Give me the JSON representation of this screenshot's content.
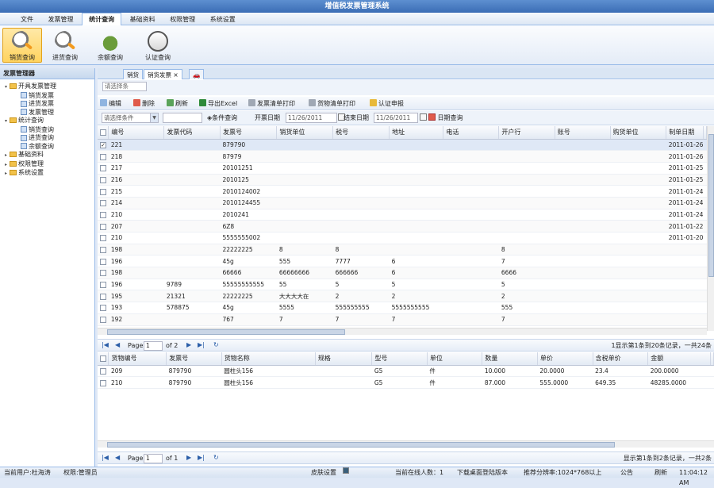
{
  "app": {
    "title": "增值税发票管理系统"
  },
  "menu": [
    "文件",
    "发票管理",
    "统计查询",
    "基础资料",
    "权限管理",
    "系统设置"
  ],
  "ribbon": [
    {
      "label": "销货查询",
      "icon": "magnifier-icon"
    },
    {
      "label": "进货查询",
      "icon": "magnifier-icon"
    },
    {
      "label": "余额查询",
      "icon": "money-bag-icon"
    },
    {
      "label": "认证查询",
      "icon": "id-card-icon"
    }
  ],
  "sidebar": {
    "title": "发票管理器",
    "tree": [
      {
        "label": "开具发票管理",
        "level": 1,
        "expanded": true,
        "kind": "folder"
      },
      {
        "label": "销货发票",
        "level": 2,
        "kind": "doc"
      },
      {
        "label": "进货发票",
        "level": 2,
        "kind": "doc"
      },
      {
        "label": "发票管理",
        "level": 2,
        "kind": "doc"
      },
      {
        "label": "统计查询",
        "level": 1,
        "expanded": true,
        "kind": "folder"
      },
      {
        "label": "销货查询",
        "level": 2,
        "kind": "doc"
      },
      {
        "label": "进货查询",
        "level": 2,
        "kind": "doc"
      },
      {
        "label": "余额查询",
        "level": 2,
        "kind": "doc"
      },
      {
        "label": "基础资料",
        "level": 1,
        "kind": "folder"
      },
      {
        "label": "权限管理",
        "level": 1,
        "kind": "folder"
      },
      {
        "label": "系统设置",
        "level": 1,
        "kind": "folder"
      }
    ]
  },
  "tabs": [
    "销货",
    "销货发票"
  ],
  "search": {
    "placeholder": "请选择条"
  },
  "toolbar": {
    "edit": "编辑",
    "delete": "删除",
    "refresh": "刷新",
    "export": "导出Excel",
    "print_invoice": "发票清单打印",
    "print_goods": "货物清单打印",
    "certify": "认证申报"
  },
  "filter": {
    "condition_placeholder": "请选择条件",
    "condition_query": "条件查询",
    "start_label": "开票日期",
    "start_value": "11/26/2011",
    "end_label": "结束日期",
    "end_value": "11/26/2011",
    "date_query": "日期查询"
  },
  "grid1": {
    "columns": [
      "编号",
      "发票代码",
      "发票号",
      "销货单位",
      "税号",
      "地址",
      "电话",
      "开户行",
      "账号",
      "购货单位",
      "制单日期"
    ],
    "rows": [
      {
        "checked": true,
        "cells": [
          "221",
          "",
          "879790",
          "",
          "",
          "",
          "",
          "",
          "",
          "",
          "2011-01-26"
        ]
      },
      {
        "cells": [
          "218",
          "",
          "87979",
          "",
          "",
          "",
          "",
          "",
          "",
          "",
          "2011-01-26"
        ]
      },
      {
        "cells": [
          "217",
          "",
          "20101251",
          "",
          "",
          "",
          "",
          "",
          "",
          "",
          "2011-01-25"
        ]
      },
      {
        "cells": [
          "216",
          "",
          "2010125",
          "",
          "",
          "",
          "",
          "",
          "",
          "",
          "2011-01-25"
        ]
      },
      {
        "cells": [
          "215",
          "",
          "2010124002",
          "",
          "",
          "",
          "",
          "",
          "",
          "",
          "2011-01-24"
        ]
      },
      {
        "cells": [
          "214",
          "",
          "2010124455",
          "",
          "",
          "",
          "",
          "",
          "",
          "",
          "2011-01-24"
        ]
      },
      {
        "cells": [
          "210",
          "",
          "2010241",
          "",
          "",
          "",
          "",
          "",
          "",
          "",
          "2011-01-24"
        ]
      },
      {
        "cells": [
          "207",
          "",
          "6Z8",
          "",
          "",
          "",
          "",
          "",
          "",
          "",
          "2011-01-22"
        ]
      },
      {
        "cells": [
          "210",
          "",
          "5555555002",
          "",
          "",
          "",
          "",
          "",
          "",
          "",
          "2011-01-20"
        ]
      },
      {
        "cells": [
          "198",
          "",
          "22222225",
          "8",
          "8",
          "",
          "",
          "8",
          "",
          "",
          ""
        ]
      },
      {
        "cells": [
          "196",
          "",
          "45g",
          "555",
          "7777",
          "6",
          "",
          "7",
          "",
          "",
          ""
        ]
      },
      {
        "cells": [
          "198",
          "",
          "66666",
          "66666666",
          "666666",
          "6",
          "",
          "6666",
          "",
          "",
          ""
        ]
      },
      {
        "cells": [
          "196",
          "9789",
          "55555555555",
          "55",
          "5",
          "5",
          "",
          "5",
          "",
          "",
          ""
        ]
      },
      {
        "cells": [
          "195",
          "21321",
          "22222225",
          "大大大大在",
          "2",
          "2",
          "",
          "2",
          "",
          "",
          ""
        ]
      },
      {
        "cells": [
          "193",
          "578875",
          "45g",
          "5555",
          "555555555",
          "5555555555",
          "",
          "555",
          "",
          "",
          ""
        ]
      },
      {
        "cells": [
          "192",
          "",
          "767",
          "7",
          "7",
          "7",
          "",
          "7",
          "",
          "",
          ""
        ]
      }
    ]
  },
  "pager1": {
    "page_label": "Page",
    "page": "1",
    "of": "of 2",
    "summary": "1显示第1条到20条记录，一共24条"
  },
  "grid2": {
    "columns": [
      "货物编号",
      "发票号",
      "货物名称",
      "规格",
      "型号",
      "单位",
      "数量",
      "单价",
      "含税单价",
      "金额"
    ],
    "rows": [
      [
        "209",
        "879790",
        "圆柱头156",
        "",
        "G5",
        "件",
        "10.000",
        "20.0000",
        "23.4",
        "200.0000"
      ],
      [
        "210",
        "879790",
        "圆柱头156",
        "",
        "G5",
        "件",
        "87.000",
        "555.0000",
        "649.35",
        "48285.0000"
      ]
    ]
  },
  "pager2": {
    "page_label": "Page",
    "page": "1",
    "of": "of 1",
    "summary": "显示第1条到2条记录，一共2条"
  },
  "status": {
    "user": "当前用户:杜海涛",
    "role": "权限:管理员",
    "skin_label": "皮肤设置",
    "online": "当前在线人数：1",
    "download": "下载桌面登陆版本",
    "resolution": "推荐分辨率:1024*768以上",
    "notice": "公告",
    "refresh": "刷新",
    "time": "11:04:12 AM"
  },
  "colors": {
    "accent": "#3b6db5",
    "selected_ribbon": "#ffd35e",
    "border": "#99bbe8"
  }
}
